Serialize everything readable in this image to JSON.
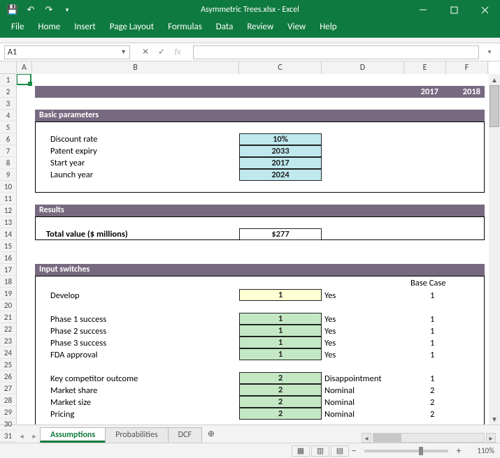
{
  "app": {
    "title": "Asymmetric Trees.xlsx  -  Excel"
  },
  "menu": {
    "items": [
      "File",
      "Home",
      "Insert",
      "Page Layout",
      "Formulas",
      "Data",
      "Review",
      "View",
      "Help"
    ]
  },
  "namebox": "A1",
  "formula": "",
  "columns": [
    "A",
    "B",
    "C",
    "D",
    "E",
    "F"
  ],
  "rows": [
    "1",
    "2",
    "3",
    "4",
    "5",
    "6",
    "7",
    "8",
    "9",
    "10",
    "11",
    "12",
    "13",
    "14",
    "15",
    "16",
    "17",
    "18",
    "19",
    "20",
    "21",
    "22",
    "23",
    "24",
    "25",
    "26",
    "27",
    "28",
    "29",
    "30",
    "31"
  ],
  "years": {
    "y1": "2017",
    "y2": "2018"
  },
  "sections": {
    "basic": {
      "title": "Basic parameters",
      "rows": [
        {
          "label": "Discount rate",
          "value": "10%"
        },
        {
          "label": "Patent expiry",
          "value": "2033"
        },
        {
          "label": "Start year",
          "value": "2017"
        },
        {
          "label": "Launch year",
          "value": "2024"
        }
      ]
    },
    "results": {
      "title": "Results",
      "label": "Total value ($ millions)",
      "value": "$277"
    },
    "switches": {
      "title": "Input switches",
      "base_header": "Base Case",
      "groups": [
        {
          "style": "yellow",
          "rows": [
            {
              "label": "Develop",
              "value": "1",
              "text": "Yes",
              "base": "1"
            }
          ]
        },
        {
          "style": "green",
          "rows": [
            {
              "label": "Phase 1 success",
              "value": "1",
              "text": "Yes",
              "base": "1"
            },
            {
              "label": "Phase 2 success",
              "value": "1",
              "text": "Yes",
              "base": "1"
            },
            {
              "label": "Phase 3 success",
              "value": "1",
              "text": "Yes",
              "base": "1"
            },
            {
              "label": "FDA approval",
              "value": "1",
              "text": "Yes",
              "base": "1"
            }
          ]
        },
        {
          "style": "green",
          "rows": [
            {
              "label": "Key competitor outcome",
              "value": "2",
              "text": "Disappointment",
              "base": "1"
            },
            {
              "label": "Market share",
              "value": "2",
              "text": "Nominal",
              "base": "2"
            },
            {
              "label": "Market size",
              "value": "2",
              "text": "Nominal",
              "base": "2"
            },
            {
              "label": "Pricing",
              "value": "2",
              "text": "Nominal",
              "base": "2"
            }
          ]
        }
      ]
    }
  },
  "tabs": {
    "items": [
      "Assumptions",
      "Probabilities",
      "DCF"
    ],
    "active": 0
  },
  "status": {
    "zoom": "110%"
  }
}
